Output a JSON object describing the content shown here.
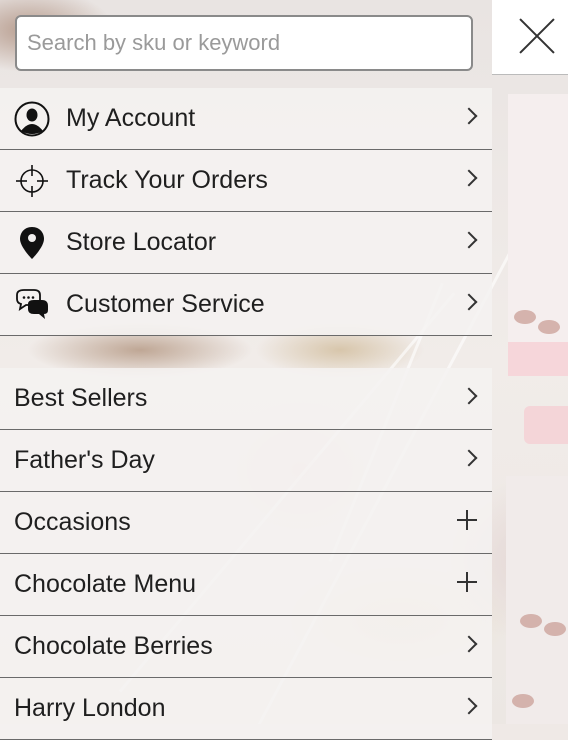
{
  "search": {
    "placeholder": "Search by sku or keyword"
  },
  "header": {
    "close_icon": "close-icon"
  },
  "account_menu": [
    {
      "label": "My Account",
      "icon": "user-icon",
      "action": "chevron"
    },
    {
      "label": "Track Your Orders",
      "icon": "crosshair-icon",
      "action": "chevron"
    },
    {
      "label": "Store Locator",
      "icon": "location-pin-icon",
      "action": "chevron"
    },
    {
      "label": "Customer Service",
      "icon": "chat-bubbles-icon",
      "action": "chevron"
    }
  ],
  "category_menu": [
    {
      "label": "Best Sellers",
      "action": "chevron"
    },
    {
      "label": "Father's Day",
      "action": "chevron"
    },
    {
      "label": "Occasions",
      "action": "plus"
    },
    {
      "label": "Chocolate Menu",
      "action": "plus"
    },
    {
      "label": "Chocolate Berries",
      "action": "chevron"
    },
    {
      "label": "Harry London",
      "action": "chevron"
    }
  ],
  "colors": {
    "divider": "#6a6a6a",
    "text": "#1f1f1f",
    "accent_pink": "#f6d6da"
  }
}
